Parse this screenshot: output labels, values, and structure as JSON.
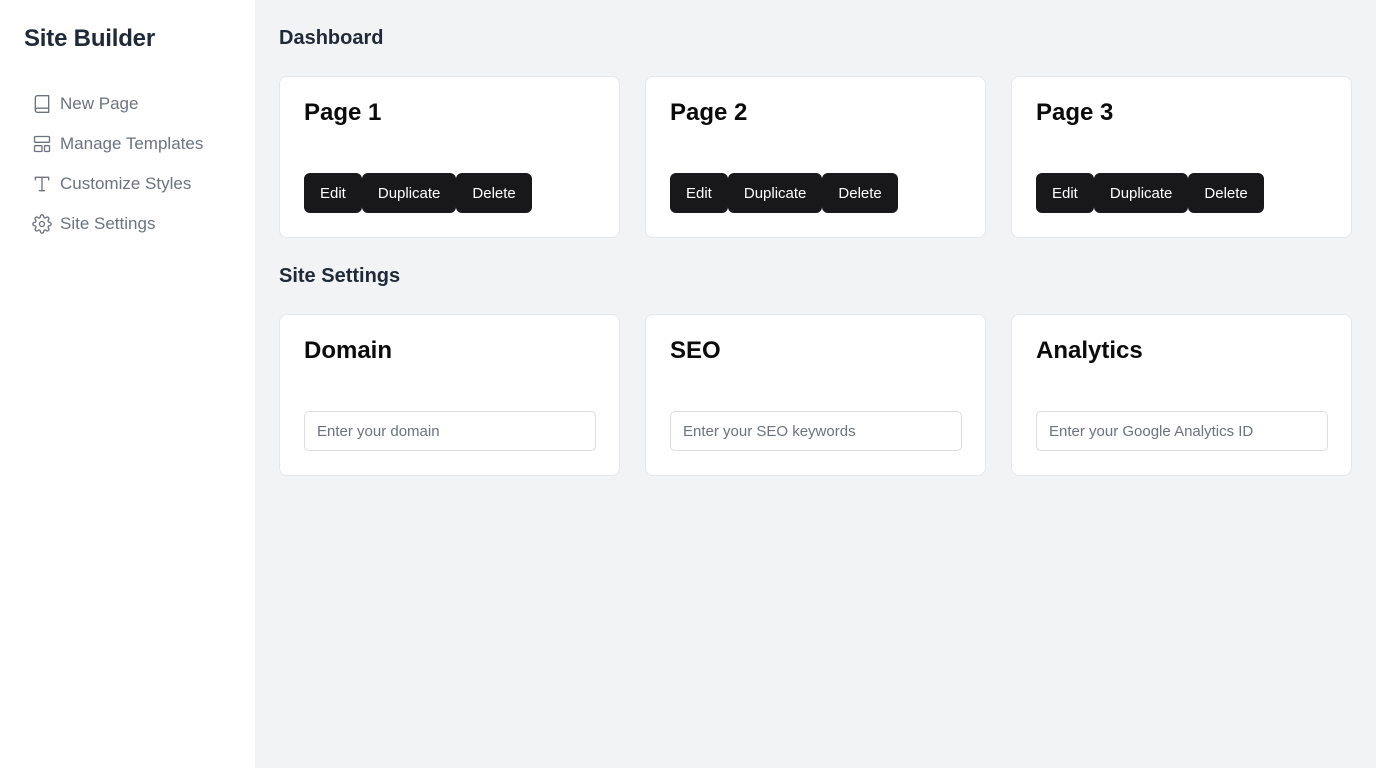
{
  "sidebar": {
    "brand": "Site Builder",
    "items": [
      {
        "label": "New Page",
        "icon": "book-icon"
      },
      {
        "label": "Manage Templates",
        "icon": "layout-icon"
      },
      {
        "label": "Customize Styles",
        "icon": "type-icon"
      },
      {
        "label": "Site Settings",
        "icon": "gear-icon"
      }
    ]
  },
  "dashboard": {
    "title": "Dashboard",
    "pages": [
      {
        "title": "Page 1",
        "actions": {
          "edit": "Edit",
          "duplicate": "Duplicate",
          "delete": "Delete"
        }
      },
      {
        "title": "Page 2",
        "actions": {
          "edit": "Edit",
          "duplicate": "Duplicate",
          "delete": "Delete"
        }
      },
      {
        "title": "Page 3",
        "actions": {
          "edit": "Edit",
          "duplicate": "Duplicate",
          "delete": "Delete"
        }
      }
    ]
  },
  "settings": {
    "title": "Site Settings",
    "cards": [
      {
        "title": "Domain",
        "value": "",
        "placeholder": "Enter your domain"
      },
      {
        "title": "SEO",
        "value": "",
        "placeholder": "Enter your SEO keywords"
      },
      {
        "title": "Analytics",
        "value": "",
        "placeholder": "Enter your Google Analytics ID"
      }
    ]
  },
  "colors": {
    "button_bg": "#18181b",
    "page_bg": "#f2f3f5",
    "nav_text": "#6b7280"
  }
}
